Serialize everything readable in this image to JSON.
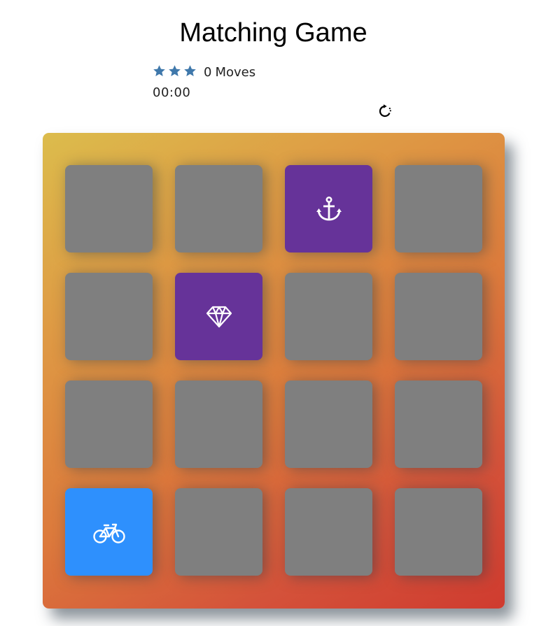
{
  "header": {
    "title": "Matching Game"
  },
  "score_panel": {
    "stars": [
      {
        "icon": "star-icon",
        "filled": true
      },
      {
        "icon": "star-icon",
        "filled": true
      },
      {
        "icon": "star-icon",
        "filled": true
      }
    ],
    "moves_count": "0",
    "moves_label": "Moves",
    "timer": "00:00",
    "restart_icon": "restart-icon"
  },
  "colors": {
    "card_hidden": "#7f7f7f",
    "card_open": "#663399",
    "card_show": "#2e90fd",
    "star": "#3f78ab"
  },
  "deck": {
    "rows": 4,
    "cols": 4,
    "cards": [
      {
        "state": "hidden",
        "icon": ""
      },
      {
        "state": "hidden",
        "icon": ""
      },
      {
        "state": "open",
        "icon": "anchor-icon"
      },
      {
        "state": "hidden",
        "icon": ""
      },
      {
        "state": "hidden",
        "icon": ""
      },
      {
        "state": "open",
        "icon": "diamond-icon"
      },
      {
        "state": "hidden",
        "icon": ""
      },
      {
        "state": "hidden",
        "icon": ""
      },
      {
        "state": "hidden",
        "icon": ""
      },
      {
        "state": "hidden",
        "icon": ""
      },
      {
        "state": "hidden",
        "icon": ""
      },
      {
        "state": "hidden",
        "icon": ""
      },
      {
        "state": "show",
        "icon": "bicycle-icon"
      },
      {
        "state": "hidden",
        "icon": ""
      },
      {
        "state": "hidden",
        "icon": ""
      },
      {
        "state": "hidden",
        "icon": ""
      }
    ]
  }
}
